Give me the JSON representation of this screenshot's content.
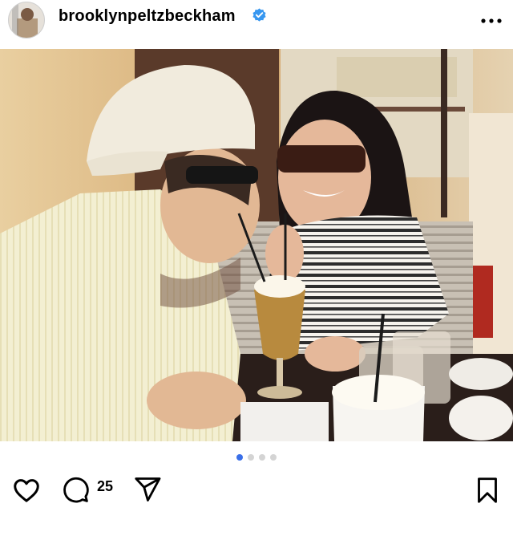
{
  "post": {
    "username": "brooklynpeltzbeckham",
    "verified_icon": "verified-badge-icon",
    "more_icon": "more-options-icon",
    "carousel": {
      "count": 4,
      "active_index": 0
    },
    "actions": {
      "like_icon": "heart-icon",
      "comment_icon": "comment-icon",
      "comment_count": "25",
      "share_icon": "send-icon",
      "save_icon": "bookmark-icon"
    }
  },
  "colors": {
    "accent": "#3a6fe8",
    "verified": "#3797f0",
    "text": "#000000",
    "dot_inactive": "#d4d4d4"
  }
}
